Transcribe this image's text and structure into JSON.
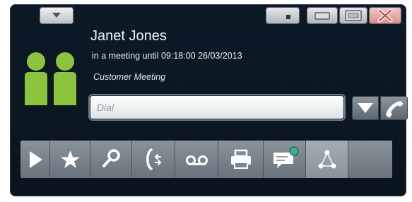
{
  "contact": {
    "name": "Janet Jones",
    "status": "in a meeting until 09:18:00 26/03/2013",
    "note": "Customer Meeting"
  },
  "dial": {
    "placeholder": "Dial",
    "value": ""
  },
  "toolbar": {
    "tools": [
      "play-icon",
      "star-icon",
      "search-icon",
      "call-transfer-icon",
      "voicemail-icon",
      "printer-icon",
      "chat-bubble-icon",
      "network-icon"
    ]
  },
  "colors": {
    "window_background": "#0b1722",
    "avatar_green": "#8cc43d",
    "presence_teal": "#2fb39a",
    "close_button": "#e59a93",
    "toolbar_gray": "#7d868d"
  }
}
